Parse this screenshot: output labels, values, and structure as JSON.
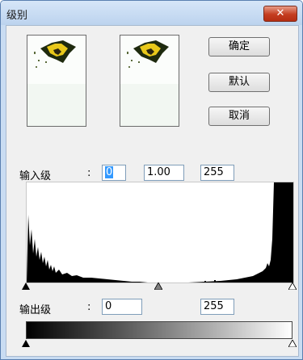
{
  "window": {
    "title": "级别",
    "close_glyph": "✕"
  },
  "buttons": {
    "ok": "确定",
    "default": "默认",
    "cancel": "取消"
  },
  "input_levels": {
    "label": "输入级",
    "colon": ":",
    "black": "0",
    "gamma": "1.00",
    "white": "255"
  },
  "output_levels": {
    "label": "输出级",
    "colon": ":",
    "black": "0",
    "white": "255"
  },
  "slider_icon": "triangle-marker",
  "colors": {
    "accent": "#3399ff",
    "close": "#c43d20"
  }
}
